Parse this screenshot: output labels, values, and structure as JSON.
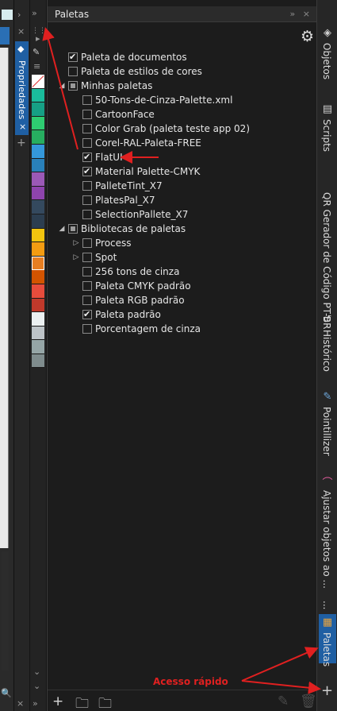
{
  "app": {
    "colors": {
      "panel_bg": "#1c1c1c",
      "header_bg": "#2b2b2b",
      "tab_active": "#1f5fa3",
      "annotation": "#e02020"
    }
  },
  "left_controls": {
    "props_tab_label": "Propriedades",
    "close_icon": "×",
    "add_icon": "+",
    "collapse_icon": "»",
    "menu_icon": "≡"
  },
  "palette_column": {
    "swatches": [
      "none",
      "#1abc9c",
      "#16a085",
      "#2ecc71",
      "#27ae60",
      "#3498db",
      "#2980b9",
      "#9b59b6",
      "#8e44ad",
      "#34495e",
      "#2c3e50",
      "#f1c40f",
      "#f39c12",
      "#e67e22",
      "#d35400",
      "#e74c3c",
      "#c0392b",
      "#ecf0f1",
      "#bdc3c7",
      "#95a5a6",
      "#7f8c8d"
    ],
    "selected_index": 13
  },
  "docker": {
    "title": "Paletas",
    "header_buttons": "» ×",
    "tree": [
      {
        "indent": 0,
        "expander": "",
        "checkbox": "checked",
        "label": "Paleta de documentos"
      },
      {
        "indent": 0,
        "expander": "",
        "checkbox": "unchecked",
        "label": "Paleta de estilos de cores"
      },
      {
        "indent": 0,
        "expander": "◢",
        "checkbox": "partial",
        "label": "Minhas paletas"
      },
      {
        "indent": 1,
        "expander": "",
        "checkbox": "unchecked",
        "label": "50-Tons-de-Cinza-Palette.xml"
      },
      {
        "indent": 1,
        "expander": "",
        "checkbox": "unchecked",
        "label": "CartoonFace"
      },
      {
        "indent": 1,
        "expander": "",
        "checkbox": "unchecked",
        "label": "Color Grab (paleta teste app 02)"
      },
      {
        "indent": 1,
        "expander": "",
        "checkbox": "unchecked",
        "label": "Corel-RAL-Paleta-FREE"
      },
      {
        "indent": 1,
        "expander": "",
        "checkbox": "checked",
        "label": "FlatUI"
      },
      {
        "indent": 1,
        "expander": "",
        "checkbox": "checked",
        "label": "Material Palette-CMYK"
      },
      {
        "indent": 1,
        "expander": "",
        "checkbox": "unchecked",
        "label": "PalleteTint_X7"
      },
      {
        "indent": 1,
        "expander": "",
        "checkbox": "unchecked",
        "label": "PlatesPal_X7"
      },
      {
        "indent": 1,
        "expander": "",
        "checkbox": "unchecked",
        "label": "SelectionPallete_X7"
      },
      {
        "indent": 0,
        "expander": "◢",
        "checkbox": "partial",
        "label": "Bibliotecas de paletas"
      },
      {
        "indent": 1,
        "expander": "▷",
        "checkbox": "unchecked",
        "label": "Process"
      },
      {
        "indent": 1,
        "expander": "▷",
        "checkbox": "unchecked",
        "label": "Spot"
      },
      {
        "indent": 1,
        "expander": "",
        "checkbox": "unchecked",
        "label": "256 tons de cinza"
      },
      {
        "indent": 1,
        "expander": "",
        "checkbox": "unchecked",
        "label": "Paleta CMYK padrão"
      },
      {
        "indent": 1,
        "expander": "",
        "checkbox": "unchecked",
        "label": "Paleta RGB padrão"
      },
      {
        "indent": 1,
        "expander": "",
        "checkbox": "checked",
        "label": "Paleta padrão"
      },
      {
        "indent": 1,
        "expander": "",
        "checkbox": "unchecked",
        "label": "Porcentagem de cinza"
      }
    ],
    "bottom_buttons": [
      {
        "icon": "new-palette-icon",
        "glyph": "+"
      },
      {
        "icon": "open-palette-icon",
        "glyph": "🗀"
      },
      {
        "icon": "new-palette-from-selection-icon",
        "glyph": "🗀"
      },
      {
        "icon": "edit-palette-icon",
        "glyph": "✎"
      },
      {
        "icon": "delete-palette-icon",
        "glyph": "🗑"
      }
    ]
  },
  "right_tabs": [
    {
      "icon": "objects-icon",
      "glyph": "◈",
      "label": "Objetos"
    },
    {
      "icon": "scripts-icon",
      "glyph": "▤",
      "label": "Scripts"
    },
    {
      "icon": "",
      "glyph": "",
      "label": "QR Gerador de Código PT-BR"
    },
    {
      "icon": "history-icon",
      "glyph": "↺",
      "label": "Histórico"
    },
    {
      "icon": "pointillizer-icon",
      "glyph": "✎",
      "label": "Pointillizer"
    },
    {
      "icon": "adjust-icon",
      "glyph": "⌒",
      "label": "Ajustar objetos ao ..."
    },
    {
      "icon": "",
      "glyph": "",
      "label": "..."
    },
    {
      "icon": "palettes-icon",
      "glyph": "▦",
      "label": "Paletas"
    }
  ],
  "right_strip_add": "+",
  "annotation": {
    "label": "Acesso rápido"
  }
}
